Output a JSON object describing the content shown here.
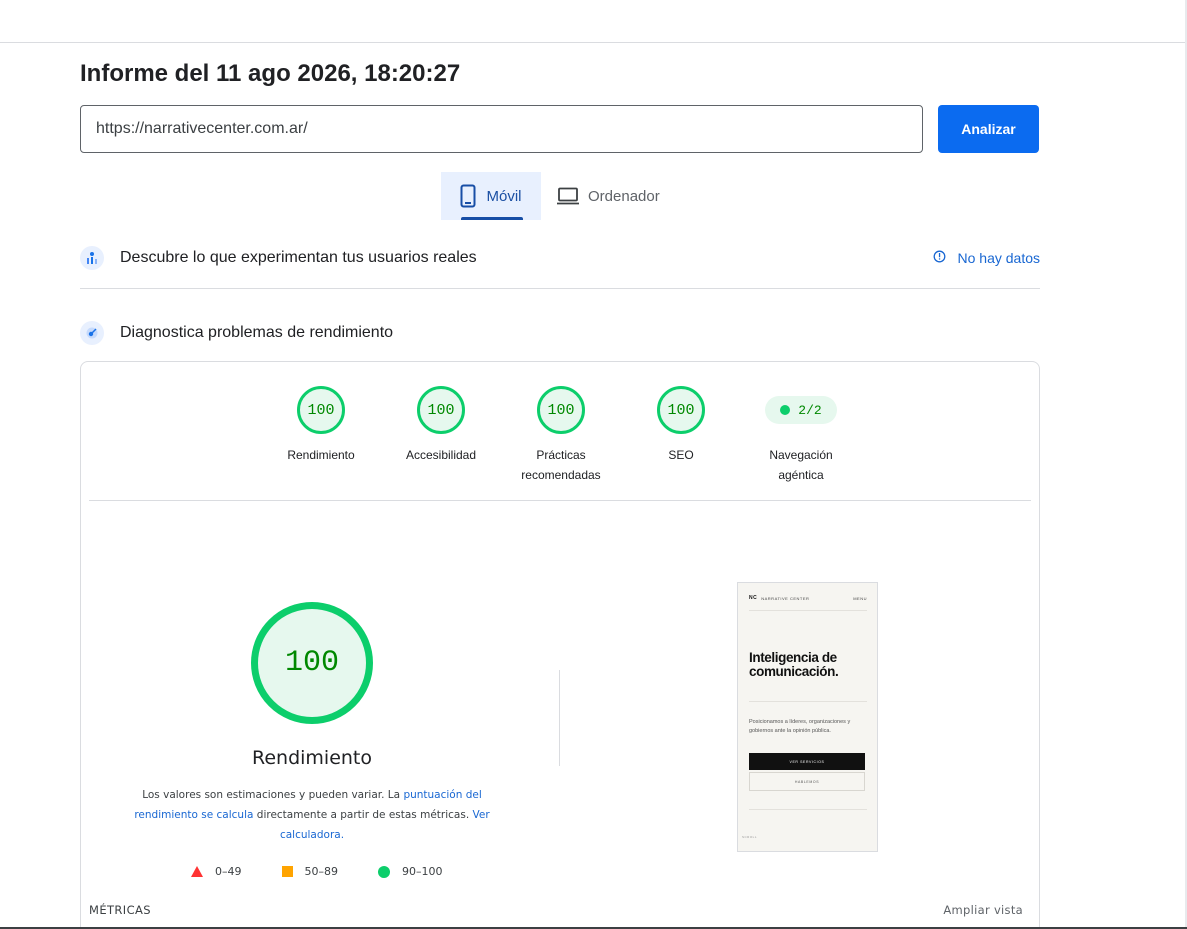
{
  "report": {
    "title": "Informe del 11 ago 2026, 18:20:27",
    "url_value": "https://narrativecenter.com.ar/",
    "analyze_label": "Analizar"
  },
  "tabs": [
    {
      "label": "Móvil",
      "icon": "smartphone-icon",
      "active": true
    },
    {
      "label": "Ordenador",
      "icon": "laptop-icon",
      "active": false
    }
  ],
  "crux_section": {
    "title": "Descubre lo que experimentan tus usuarios reales",
    "icon": "users-chart-icon",
    "status_label": "No hay datos",
    "status_icon": "info-icon"
  },
  "diagnostics_section": {
    "title": "Diagnostica problemas de rendimiento",
    "icon": "gauge-icon"
  },
  "scores": [
    {
      "value": "100",
      "label_line1": "Rendimiento",
      "label_line2": ""
    },
    {
      "value": "100",
      "label_line1": "Accesibilidad",
      "label_line2": ""
    },
    {
      "value": "100",
      "label_line1": "Prácticas",
      "label_line2": "recomendadas"
    },
    {
      "value": "100",
      "label_line1": "SEO",
      "label_line2": ""
    }
  ],
  "agentic": {
    "value": "2/2",
    "label_line1": "Navegación",
    "label_line2": "agéntica"
  },
  "performance": {
    "score": "100",
    "title": "Rendimiento",
    "disclaimer_pre": "Los valores son estimaciones y pueden variar. La ",
    "disclaimer_link1": "puntuación del rendimiento se calcula",
    "disclaimer_mid": " directamente a partir de estas métricas. ",
    "disclaimer_link2": "Ver calculadora.",
    "legend": [
      {
        "shape": "triangle",
        "range": "0–49",
        "color": "#ff3333"
      },
      {
        "shape": "square",
        "range": "50–89",
        "color": "#ffa400"
      },
      {
        "shape": "circle",
        "range": "90–100",
        "color": "#0cce6b"
      }
    ]
  },
  "screenshot": {
    "logo": "NC",
    "site_name": "NARRATIVE CENTER",
    "menu": "MENU",
    "headline": "Inteligencia de comunicación.",
    "description": "Posicionamos a líderes, organizaciones y gobiernos ante la opinión pública.",
    "primary_cta": "VER SERVICIOS",
    "secondary_cta": "HABLEMOS",
    "footer_text": "SCROLL"
  },
  "metrics": {
    "label": "MÉTRICAS",
    "expand_label": "Ampliar vista"
  },
  "colors": {
    "good": "#0cce6b",
    "accent": "#1a73e8",
    "button": "#0b6bf0"
  }
}
